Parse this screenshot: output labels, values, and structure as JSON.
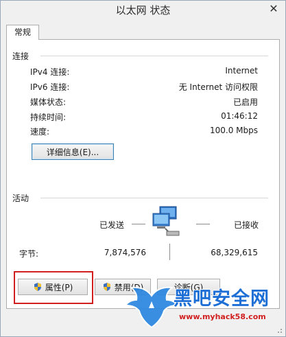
{
  "window": {
    "title": "以太网 状态",
    "close_glyph": "✕"
  },
  "tab": {
    "label": "常规"
  },
  "connection": {
    "title": "连接",
    "rows": [
      {
        "label": "IPv4 连接:",
        "value": "Internet"
      },
      {
        "label": "IPv6 连接:",
        "value": "无 Internet 访问权限"
      },
      {
        "label": "媒体状态:",
        "value": "已启用"
      },
      {
        "label": "持续时间:",
        "value": "01:46:12"
      },
      {
        "label": "速度:",
        "value": "100.0 Mbps"
      }
    ],
    "details_button": "详细信息(E)..."
  },
  "activity": {
    "title": "活动",
    "sent_label": "已发送",
    "received_label": "已接收",
    "bytes_label": "字节:",
    "bytes_sent": "7,874,576",
    "bytes_received": "68,329,615"
  },
  "buttons": {
    "properties": "属性(P)",
    "disable": "禁用(D)",
    "diagnose": "诊断(G)"
  },
  "watermark": {
    "title": "黑吧安全网",
    "url": "www.myhack58.com"
  },
  "colors": {
    "highlight": "#d11f1f",
    "watermark_blue": "#1d6fd6",
    "watermark_red": "#d11f1f"
  }
}
